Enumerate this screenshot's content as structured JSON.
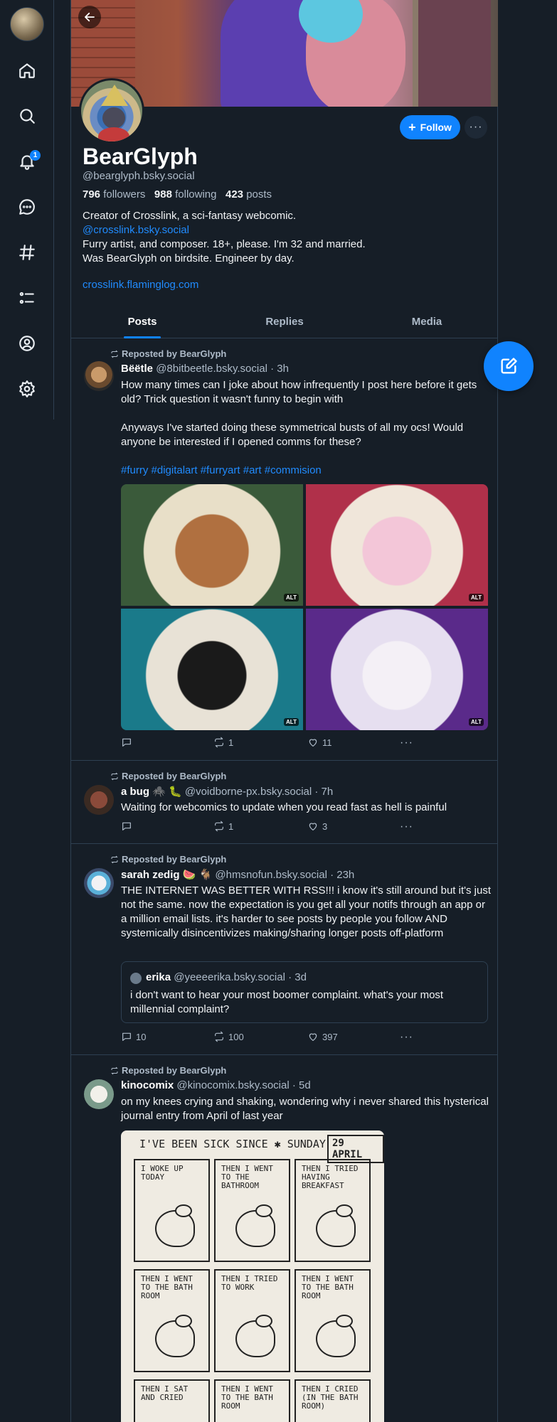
{
  "nav": {
    "notifications_badge": "1",
    "items": [
      "home-icon",
      "search-icon",
      "bell-icon",
      "chat-icon",
      "hashtag-icon",
      "list-icon",
      "profile-icon",
      "gear-icon"
    ]
  },
  "profile": {
    "display_name": "BearGlyph",
    "handle": "@bearglyph.bsky.social",
    "followers_count": "796",
    "followers_label": "followers",
    "following_count": "988",
    "following_label": "following",
    "posts_count": "423",
    "posts_label": "posts",
    "bio_line1": "Creator of Crosslink, a sci-fantasy webcomic.",
    "bio_mention": "@crosslink.bsky.social",
    "bio_line2": "Furry artist, and composer. 18+, please. I'm 32 and married.",
    "bio_line3": "Was BearGlyph on birdsite. Engineer by day.",
    "website": "crosslink.flaminglog.com",
    "follow_label": "Follow",
    "more_label": "···"
  },
  "tabs": [
    {
      "label": "Posts",
      "active": true
    },
    {
      "label": "Replies",
      "active": false
    },
    {
      "label": "Media",
      "active": false
    }
  ],
  "posts": [
    {
      "reposted_by": "Reposted by BearGlyph",
      "author": "Bëëtle",
      "handle": "@8bitbeetle.bsky.social",
      "time": "· 3h",
      "text1": "How many times can I joke about how infrequently I post here before it gets old? Trick question it wasn't funny to begin with",
      "text2": "Anyways I've started doing these symmetrical busts of all my ocs! Would anyone be interested if I opened comms for these?",
      "hashtags": "#furry #digitalart #furryart #art #commision",
      "image_alt_badge": "ALT",
      "replies": "",
      "reposts": "1",
      "likes": "11"
    },
    {
      "reposted_by": "Reposted by BearGlyph",
      "author": "a bug 🕷️ 🐛",
      "handle": "@voidborne-px.bsky.social",
      "time": "· 7h",
      "text1": "Waiting for webcomics to update when you read fast as hell is painful",
      "replies": "",
      "reposts": "1",
      "likes": "3"
    },
    {
      "reposted_by": "Reposted by BearGlyph",
      "author": "sarah zedig 🍉 🐐",
      "handle": "@hmsnofun.bsky.social",
      "time": "· 23h",
      "text1": "THE INTERNET WAS BETTER WITH RSS!!! i know it's still around but it's just not the same. now the expectation is you get all your notifs through an app or a million email lists. it's harder to see posts by people you follow AND systemically disincentivizes making/sharing longer posts off-platform",
      "quote_author": "erika",
      "quote_handle": "@yeeeerika.bsky.social",
      "quote_time": "· 3d",
      "quote_text": "i don't want to hear your most boomer complaint. what's your most millennial complaint?",
      "replies": "10",
      "reposts": "100",
      "likes": "397"
    },
    {
      "reposted_by": "Reposted by BearGlyph",
      "author": "kinocomix",
      "handle": "@kinocomix.bsky.social",
      "time": "· 5d",
      "text1": "on my knees crying and shaking, wondering why i never shared this hysterical journal entry from April of last year",
      "comic_title": "I'VE BEEN SICK SINCE ✱ SUNDAY",
      "comic_date": "29 APRIL",
      "comic_panels": [
        "I WOKE UP TODAY",
        "THEN I WENT TO THE BATHROOM",
        "THEN I TRIED HAVING BREAKFAST",
        "THEN I WENT TO THE BATH ROOM",
        "THEN I TRIED TO WORK",
        "THEN I WENT TO THE BATH ROOM",
        "THEN I SAT AND CRIED",
        "THEN I WENT TO THE BATH ROOM",
        "THEN I CRIED (IN THE BATH ROOM)"
      ]
    }
  ],
  "colors": {
    "background": "#161e27",
    "accent": "#1083fe",
    "link": "#208bfe",
    "border": "#2e4052",
    "muted_text": "#aebbc9"
  }
}
